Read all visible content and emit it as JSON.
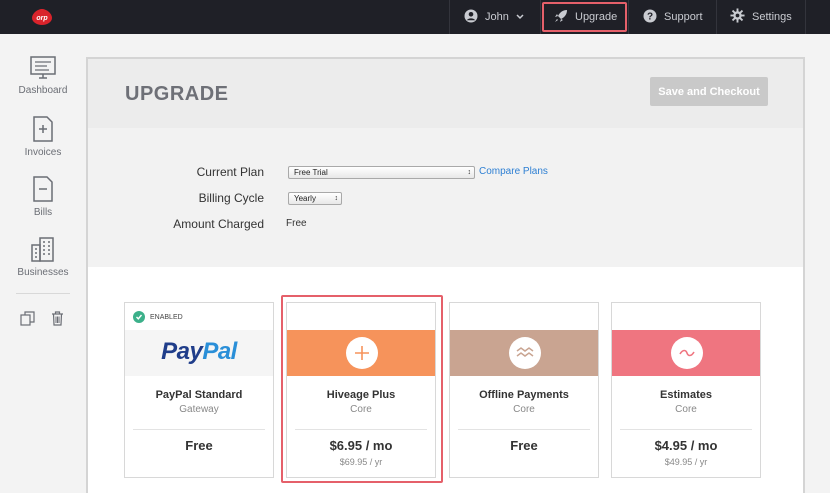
{
  "topbar": {
    "user_name": "John",
    "upgrade_label": "Upgrade",
    "support_label": "Support",
    "settings_label": "Settings",
    "icons": [
      "logo-icon",
      "user-icon",
      "chevron-down-icon",
      "rocket-icon",
      "help-icon",
      "gear-icon"
    ]
  },
  "sidebar": {
    "items": [
      {
        "label": "Dashboard",
        "icon": "dashboard-icon"
      },
      {
        "label": "Invoices",
        "icon": "invoice-icon"
      },
      {
        "label": "Bills",
        "icon": "bill-icon"
      },
      {
        "label": "Businesses",
        "icon": "buildings-icon"
      }
    ],
    "tools": [
      "copy-icon",
      "trash-icon"
    ]
  },
  "page": {
    "title": "UPGRADE",
    "save_label": "Save and Checkout"
  },
  "form": {
    "current_plan_label": "Current Plan",
    "current_plan_value": "Free Trial",
    "compare_link": "Compare Plans",
    "billing_cycle_label": "Billing Cycle",
    "billing_cycle_value": "Yearly",
    "amount_label": "Amount Charged",
    "amount_value": "Free"
  },
  "cards": [
    {
      "name": "PayPal Standard",
      "sub": "Gateway",
      "price": "Free",
      "yearly": "",
      "badge": "ENABLED",
      "logo_text": "PayPal",
      "color": "#ffffff"
    },
    {
      "name": "Hiveage Plus",
      "sub": "Core",
      "price": "$6.95 / mo",
      "yearly": "$69.95 / yr",
      "color": "#f6935b",
      "icon": "plus-icon"
    },
    {
      "name": "Offline Payments",
      "sub": "Core",
      "price": "Free",
      "yearly": "",
      "color": "#c9a491",
      "icon": "wave-icon"
    },
    {
      "name": "Estimates",
      "sub": "Core",
      "price": "$4.95 / mo",
      "yearly": "$49.95 / yr",
      "color": "#ef7580",
      "icon": "tilde-icon"
    }
  ],
  "colors": {
    "topbar": "#1f2027",
    "highlight": "#e5606a",
    "link": "#2d7fd3",
    "enabled": "#3cb08a"
  }
}
